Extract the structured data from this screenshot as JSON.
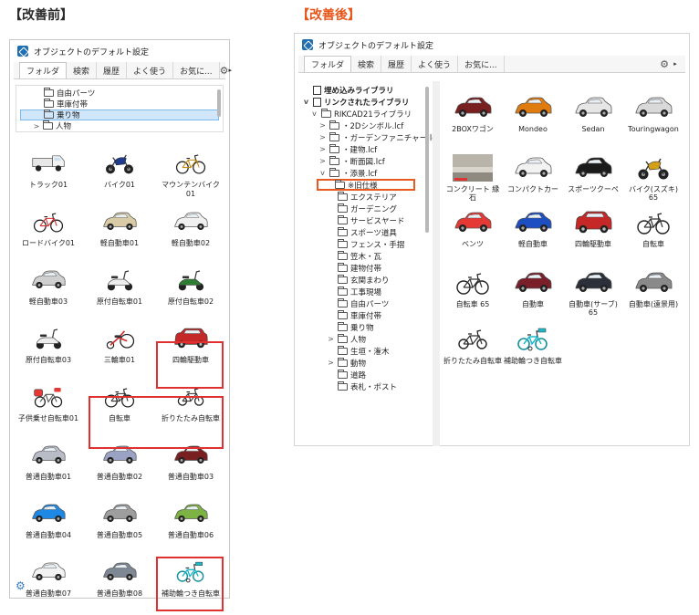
{
  "headings": {
    "before": "【改善前】",
    "after": "【改善後】"
  },
  "colors": {
    "after_heading": "#e8551a",
    "highlight_red": "#e03030",
    "selection_blue": "#cfe6fb"
  },
  "before": {
    "title": "オブジェクトのデフォルト設定",
    "tabs": [
      "フォルダ",
      "検索",
      "履歴",
      "よく使う",
      "お気に..."
    ],
    "tree": [
      {
        "label": "自由パーツ",
        "selected": false,
        "chevron": ""
      },
      {
        "label": "車庫付帯",
        "selected": false,
        "chevron": ""
      },
      {
        "label": "乗り物",
        "selected": true,
        "chevron": ""
      },
      {
        "label": "人物",
        "selected": false,
        "chevron": ">"
      }
    ],
    "grid": [
      {
        "label": "トラック01",
        "icon": "truck-icon"
      },
      {
        "label": "バイク01",
        "icon": "motorbike-icon"
      },
      {
        "label": "マウンテンバイク01",
        "icon": "bicycle-icon"
      },
      {
        "label": "ロードバイク01",
        "icon": "bicycle-icon"
      },
      {
        "label": "軽自動車01",
        "icon": "kei-car-icon"
      },
      {
        "label": "軽自動車02",
        "icon": "kei-car-icon"
      },
      {
        "label": "軽自動車03",
        "icon": "kei-car-icon"
      },
      {
        "label": "原付自転車01",
        "icon": "scooter-icon"
      },
      {
        "label": "原付自転車02",
        "icon": "scooter-icon"
      },
      {
        "label": "原付自転車03",
        "icon": "scooter-icon"
      },
      {
        "label": "三輪車01",
        "icon": "tricycle-icon"
      },
      {
        "label": "四輪駆動車",
        "icon": "suv-icon"
      },
      {
        "label": "子供乗せ自転車01",
        "icon": "child-bicycle-icon"
      },
      {
        "label": "自転車",
        "icon": "bicycle-icon"
      },
      {
        "label": "折りたたみ自転車",
        "icon": "folding-bicycle-icon"
      },
      {
        "label": "普通自動車01",
        "icon": "car-icon"
      },
      {
        "label": "普通自動車02",
        "icon": "car-icon"
      },
      {
        "label": "普通自動車03",
        "icon": "car-icon"
      },
      {
        "label": "普通自動車04",
        "icon": "car-icon"
      },
      {
        "label": "普通自動車05",
        "icon": "car-icon"
      },
      {
        "label": "普通自動車06",
        "icon": "car-icon"
      },
      {
        "label": "普通自動車07",
        "icon": "car-icon"
      },
      {
        "label": "普通自動車08",
        "icon": "car-icon"
      },
      {
        "label": "補助輪つき自転車",
        "icon": "training-bicycle-icon"
      }
    ]
  },
  "after": {
    "title": "オブジェクトのデフォルト設定",
    "tabs": [
      "フォルダ",
      "検索",
      "履歴",
      "よく使う",
      "お気に..."
    ],
    "tree": [
      {
        "label": "埋め込みライブラリ",
        "chevron": "",
        "indent": 0,
        "bold": true,
        "icon": "file-icon"
      },
      {
        "label": "リンクされたライブラリ",
        "chevron": "v",
        "indent": 0,
        "bold": true,
        "icon": "library-icon"
      },
      {
        "label": "RIKCAD21ライブラリ",
        "chevron": "v",
        "indent": 1,
        "bold": false,
        "icon": "folder-icon"
      },
      {
        "label": "・2Dシンボル.lcf",
        "chevron": ">",
        "indent": 2,
        "bold": false,
        "icon": "folder-icon"
      },
      {
        "label": "・ガーデンファニチャー.lcf",
        "chevron": ">",
        "indent": 2,
        "bold": false,
        "icon": "folder-icon"
      },
      {
        "label": "・建物.lcf",
        "chevron": ">",
        "indent": 2,
        "bold": false,
        "icon": "folder-icon"
      },
      {
        "label": "・断面図.lcf",
        "chevron": ">",
        "indent": 2,
        "bold": false,
        "icon": "folder-icon"
      },
      {
        "label": "・添景.lcf",
        "chevron": "v",
        "indent": 2,
        "bold": false,
        "icon": "folder-icon"
      },
      {
        "label": "※旧仕様",
        "chevron": "",
        "indent": 3,
        "bold": false,
        "icon": "folder-icon",
        "selected": true
      },
      {
        "label": "エクステリア",
        "chevron": "",
        "indent": 3,
        "bold": false,
        "icon": "folder-icon"
      },
      {
        "label": "ガーデニング",
        "chevron": "",
        "indent": 3,
        "bold": false,
        "icon": "folder-icon"
      },
      {
        "label": "サービスヤード",
        "chevron": "",
        "indent": 3,
        "bold": false,
        "icon": "folder-icon"
      },
      {
        "label": "スポーツ道具",
        "chevron": "",
        "indent": 3,
        "bold": false,
        "icon": "folder-icon"
      },
      {
        "label": "フェンス・手摺",
        "chevron": "",
        "indent": 3,
        "bold": false,
        "icon": "folder-icon"
      },
      {
        "label": "笠木・瓦",
        "chevron": "",
        "indent": 3,
        "bold": false,
        "icon": "folder-icon"
      },
      {
        "label": "建物付帯",
        "chevron": "",
        "indent": 3,
        "bold": false,
        "icon": "folder-icon"
      },
      {
        "label": "玄関まわり",
        "chevron": "",
        "indent": 3,
        "bold": false,
        "icon": "folder-icon"
      },
      {
        "label": "工事現場",
        "chevron": "",
        "indent": 3,
        "bold": false,
        "icon": "folder-icon"
      },
      {
        "label": "自由パーツ",
        "chevron": "",
        "indent": 3,
        "bold": false,
        "icon": "folder-icon"
      },
      {
        "label": "車庫付帯",
        "chevron": "",
        "indent": 3,
        "bold": false,
        "icon": "folder-icon"
      },
      {
        "label": "乗り物",
        "chevron": "",
        "indent": 3,
        "bold": false,
        "icon": "folder-icon"
      },
      {
        "label": "人物",
        "chevron": ">",
        "indent": 3,
        "bold": false,
        "icon": "folder-icon"
      },
      {
        "label": "生垣・潅木",
        "chevron": "",
        "indent": 3,
        "bold": false,
        "icon": "folder-icon"
      },
      {
        "label": "動物",
        "chevron": ">",
        "indent": 3,
        "bold": false,
        "icon": "folder-icon"
      },
      {
        "label": "道路",
        "chevron": "",
        "indent": 3,
        "bold": false,
        "icon": "folder-icon"
      },
      {
        "label": "表札・ポスト",
        "chevron": "",
        "indent": 3,
        "bold": false,
        "icon": "folder-icon"
      }
    ],
    "grid": [
      {
        "label": "2BOXワゴン",
        "icon": "car-icon"
      },
      {
        "label": "Mondeo",
        "icon": "car-icon"
      },
      {
        "label": "Sedan",
        "icon": "car-icon"
      },
      {
        "label": "Touringwagon",
        "icon": "car-icon"
      },
      {
        "label": "コンクリート 縁石",
        "icon": "curb-icon"
      },
      {
        "label": "コンパクトカー",
        "icon": "car-icon"
      },
      {
        "label": "スポーツクーペ",
        "icon": "car-icon"
      },
      {
        "label": "バイク(スズキ) 65",
        "icon": "motorbike-icon"
      },
      {
        "label": "ベンツ",
        "icon": "car-icon"
      },
      {
        "label": "軽自動車",
        "icon": "car-icon"
      },
      {
        "label": "四輪駆動車",
        "icon": "suv-icon"
      },
      {
        "label": "自転車",
        "icon": "bicycle-icon"
      },
      {
        "label": "自転車 65",
        "icon": "bicycle-icon"
      },
      {
        "label": "自動車",
        "icon": "car-icon"
      },
      {
        "label": "自動車(サーブ) 65",
        "icon": "car-icon"
      },
      {
        "label": "自動車(遠景用)",
        "icon": "car-icon"
      },
      {
        "label": "折りたたみ自転車",
        "icon": "folding-bicycle-icon"
      },
      {
        "label": "補助輪つき自転車",
        "icon": "training-bicycle-icon"
      }
    ]
  }
}
